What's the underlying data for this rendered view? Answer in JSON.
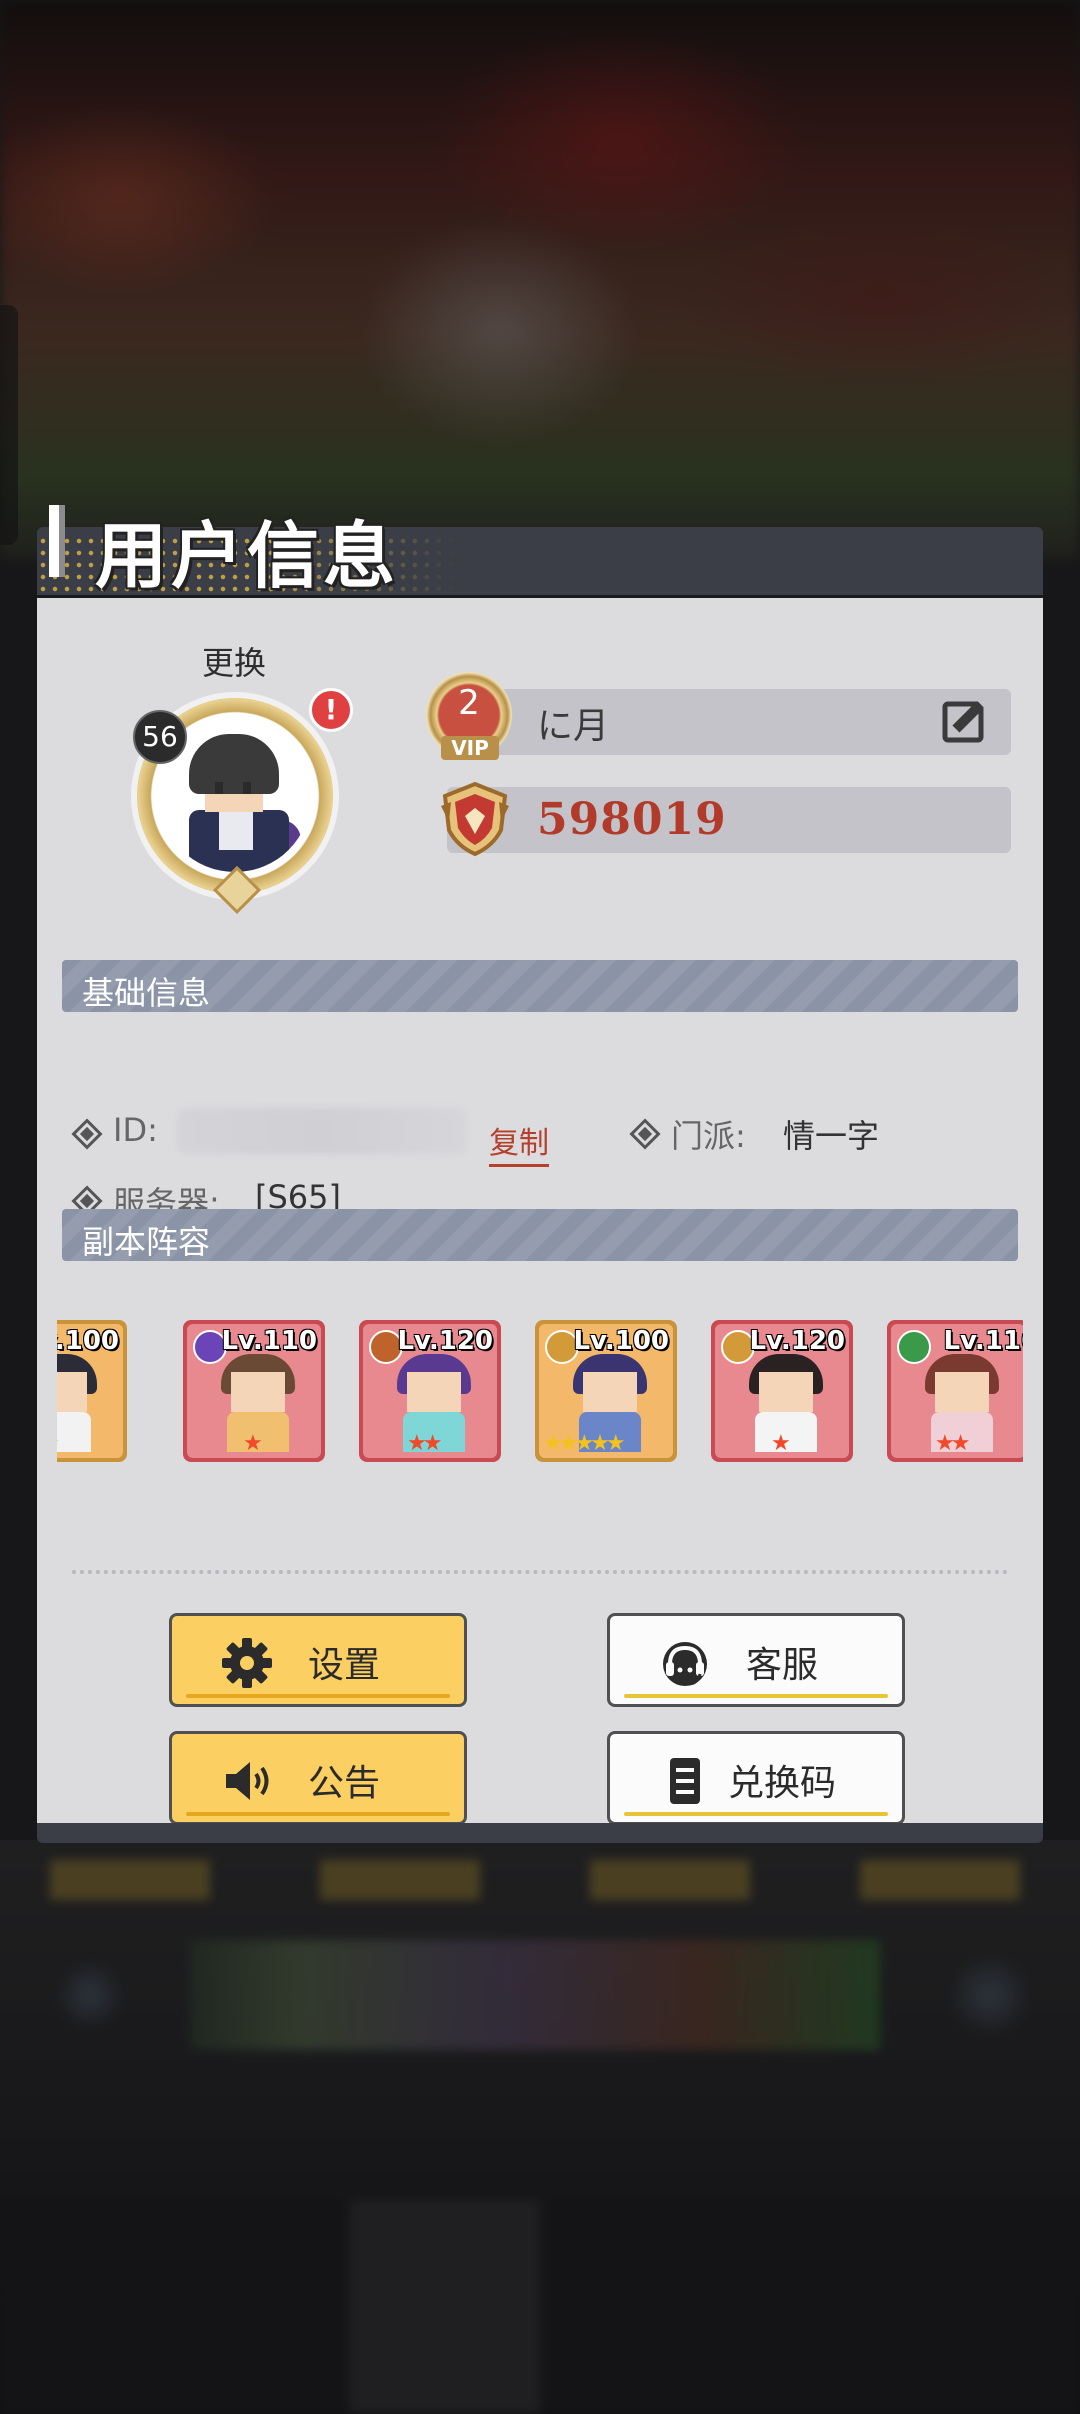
{
  "panel": {
    "title": "用户信息"
  },
  "profile": {
    "change_label": "更换",
    "level": "56",
    "alert": "!",
    "vip_level": "2",
    "vip_tag": "VIP",
    "name": "に月",
    "score": "598019"
  },
  "basic_info": {
    "section_title": "基础信息",
    "id_label": "ID:",
    "copy_label": "复制",
    "sect_label": "门派:",
    "sect_value": "情一字",
    "server_label": "服务器:",
    "server_value": "[S65]"
  },
  "lineup": {
    "section_title": "副本阵容",
    "heroes": [
      {
        "level": "Lv.100",
        "element": "",
        "stars": "★★★★"
      },
      {
        "level": "Lv.110",
        "element": "fire",
        "stars": "★"
      },
      {
        "level": "Lv.120",
        "element": "mountain",
        "stars": "★★"
      },
      {
        "level": "Lv.100",
        "element": "spirit",
        "stars": "★★★★★"
      },
      {
        "level": "Lv.120",
        "element": "spirit",
        "stars": "★"
      },
      {
        "level": "Lv.116",
        "element": "dna",
        "stars": "★★"
      }
    ]
  },
  "buttons": {
    "settings": "设置",
    "support": "客服",
    "notice": "公告",
    "redeem": "兑换码"
  },
  "colors": {
    "header": "#3b3e47",
    "body": "#dcdcdf",
    "section_bar": "#8b93a6",
    "score": "#b23a2a",
    "button_yellow": "#fccf63",
    "copy_link": "#b5402e"
  }
}
